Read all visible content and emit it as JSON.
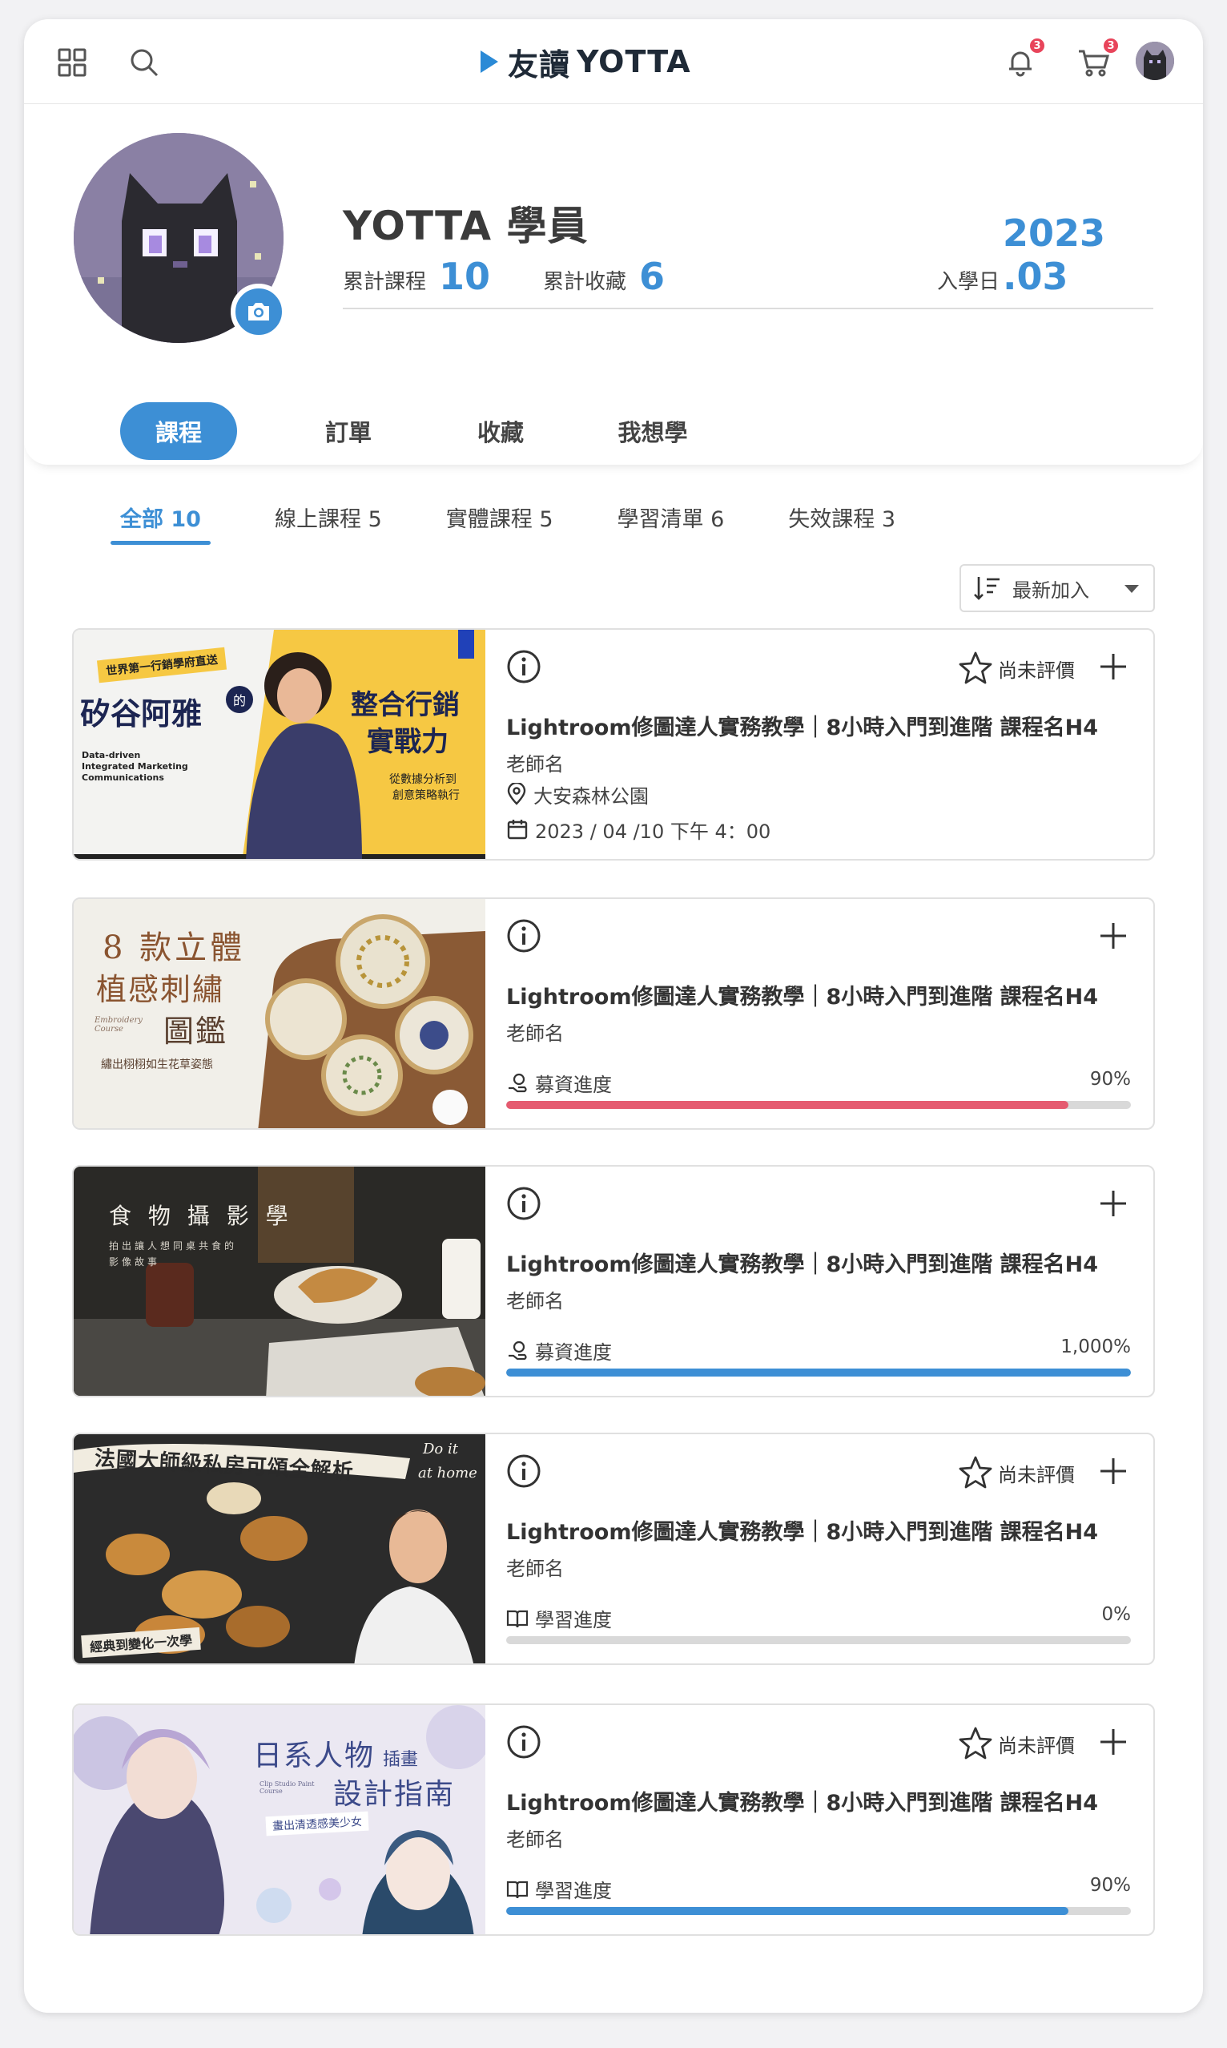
{
  "header": {
    "brand": "友讀",
    "brand_en": "YOTTA",
    "notifications_count": "3",
    "cart_count": "3",
    "icons": [
      "grid-icon",
      "search-icon",
      "bell-icon",
      "cart-icon",
      "avatar"
    ]
  },
  "profile": {
    "name": "YOTTA 學員",
    "courses_label": "累計課程",
    "courses_value": "10",
    "favorites_label": "累計收藏",
    "favorites_value": "6",
    "joined_label": "入學日",
    "joined_value": "2023 .03"
  },
  "main_tabs": [
    {
      "label": "課程",
      "active": true
    },
    {
      "label": "訂單",
      "active": false
    },
    {
      "label": "收藏",
      "active": false
    },
    {
      "label": "我想學",
      "active": false
    }
  ],
  "sub_tabs": [
    {
      "label": "全部 10",
      "active": true
    },
    {
      "label": "線上課程 5",
      "active": false
    },
    {
      "label": "實體課程 5",
      "active": false
    },
    {
      "label": "學習清單 6",
      "active": false
    },
    {
      "label": "失效課程 3",
      "active": false
    }
  ],
  "sort": {
    "label": "最新加入"
  },
  "colors": {
    "accent": "#3d8fd5",
    "badge": "#e8445a",
    "fund_bar": "#e55b70"
  },
  "courses": [
    {
      "title": "Lightroom修圖達人實務教學｜8小時入門到進階 課程名H4",
      "teacher": "老師名",
      "rating": "尚未評價",
      "location": "大安森林公園",
      "datetime": "2023 / 04 /10 下午 4：00",
      "thumb_text": [
        "世界第一行銷學府直送",
        "矽谷阿雅",
        "的",
        "整合行銷",
        "實戰力",
        "從數據分析到",
        "創意策略執行",
        "Data-driven",
        "Integrated Marketing",
        "Communications"
      ]
    },
    {
      "title": "Lightroom修圖達人實務教學｜8小時入門到進階 課程名H4",
      "teacher": "老師名",
      "progress_label": "募資進度",
      "progress_pct": "90%",
      "progress_value": 0.9,
      "thumb_text": [
        "8 款立體",
        "植感刺繡",
        "圖鑑",
        "Embroidery Course",
        "繡出栩栩如生花草姿態"
      ]
    },
    {
      "title": "Lightroom修圖達人實務教學｜8小時入門到進階 課程名H4",
      "teacher": "老師名",
      "progress_label": "募資進度",
      "progress_pct": "1,000%",
      "progress_value": 1.0,
      "thumb_text": [
        "食 物 攝 影 學",
        "拍出讓人想同桌共食的",
        "影像故事"
      ]
    },
    {
      "title": "Lightroom修圖達人實務教學｜8小時入門到進階 課程名H4",
      "teacher": "老師名",
      "rating": "尚未評價",
      "progress_label": "學習進度",
      "progress_pct": "0%",
      "progress_value": 0.0,
      "thumb_text": [
        "法國大師級私房可頌全解析",
        "Do it",
        "at home",
        "經典到變化一次學"
      ]
    },
    {
      "title": "Lightroom修圖達人實務教學｜8小時入門到進階 課程名H4",
      "teacher": "老師名",
      "rating": "尚未評價",
      "progress_label": "學習進度",
      "progress_pct": "90%",
      "progress_value": 0.9,
      "thumb_text": [
        "日系人物",
        "插畫",
        "設計指南",
        "畫出清透感美少女",
        "Clip Studio Paint Course"
      ]
    }
  ]
}
